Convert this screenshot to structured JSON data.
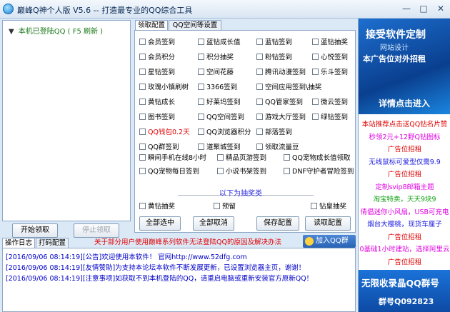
{
  "window": {
    "title": "巅峰Q神个人版 V5.6 -- 打造最专业的QQ综合工具",
    "min": "—",
    "max": "□",
    "close": "✕"
  },
  "tree": {
    "root_label": "本机已登陆QQ ( F5 刷新 )"
  },
  "left_buttons": {
    "start": "开始领取",
    "stop": "停止领取"
  },
  "tabs": [
    "领取配置",
    "QQ空间等设置"
  ],
  "checkboxes": [
    {
      "label": "会员签到",
      "red": false
    },
    {
      "label": "蓝钻成长值",
      "red": false
    },
    {
      "label": "蓝钻签到",
      "red": false
    },
    {
      "label": "蓝钻抽奖",
      "red": false
    },
    {
      "label": "会员积分",
      "red": false
    },
    {
      "label": "积分抽奖",
      "red": false
    },
    {
      "label": "粉钻签到",
      "red": false
    },
    {
      "label": "心悦签到",
      "red": false
    },
    {
      "label": "星钻签到",
      "red": false
    },
    {
      "label": "空间花藤",
      "red": false
    },
    {
      "label": "腾讯动漫签到",
      "red": false
    },
    {
      "label": "乐斗签到",
      "red": false
    },
    {
      "label": "玫瑰小镇刷树",
      "red": false
    },
    {
      "label": "3366签到",
      "red": false
    },
    {
      "label": "空间应用签到\\抽奖",
      "red": false
    },
    {
      "label": "",
      "red": false
    },
    {
      "label": "黄钻成长",
      "red": false
    },
    {
      "label": "好莱坞签到",
      "red": false
    },
    {
      "label": "QQ管家签到",
      "red": false
    },
    {
      "label": "微云签到",
      "red": false
    },
    {
      "label": "图书签到",
      "red": false
    },
    {
      "label": "QQ空间签到",
      "red": false
    },
    {
      "label": "游戏大厅签到",
      "red": false
    },
    {
      "label": "绿钻签到",
      "red": false
    },
    {
      "label": "QQ钱包0.2天",
      "red": true
    },
    {
      "label": "QQ浏览器积分",
      "red": false
    },
    {
      "label": "部落签到",
      "red": false
    },
    {
      "label": "",
      "red": false
    },
    {
      "label": "QQ群签到",
      "red": false
    },
    {
      "label": "道聚城签到",
      "red": false
    },
    {
      "label": "领取流量豆",
      "red": false
    }
  ],
  "row8": [
    {
      "label": "瞬间手机在线8小时"
    },
    {
      "label": "精品页游签到"
    },
    {
      "label": "QQ宠物成长值领取"
    }
  ],
  "row9": [
    {
      "label": "QQ宠物每日签到"
    },
    {
      "label": "小说书架签到"
    },
    {
      "label": "DNF守护者冒险签到"
    }
  ],
  "lottery": {
    "header": "以下为抽奖类",
    "items": [
      {
        "label": "黄钻抽奖"
      },
      {
        "label": "预留"
      },
      {
        "label": "钻皇抽奖"
      }
    ]
  },
  "cfg_buttons": {
    "select_all": "全部选中",
    "cancel_all": "全部取消",
    "save": "保存配置",
    "load": "读取配置"
  },
  "notice": "关于部分用户使用巅峰系列软件无法登陆QQ的原因及解决办法",
  "qq_group_btn": "加入QQ群",
  "bottom_tabs": [
    "操作日志",
    "打码配置"
  ],
  "logs": [
    "[2016/09/06 08:14:19][公告]欢迎使用本软件！ 官网http://www.52dfg.com",
    "[2016/09/06 08:14:19][友情赞助]为支持本论坛本软件不断发展更新，已设置浏览器主页，谢谢！",
    "[2016/09/06 08:14:19][注意事项]如获取不到本机登陆的QQ，请重启电脑或重新安装官方原新QQ！"
  ],
  "ad": {
    "banner_big": "接受软件定制",
    "banner_small": "网站设计",
    "banner_mid": "本广告位对外招租",
    "banner_cta": "详情点击进入",
    "lines": [
      {
        "text": "本站推荐点击送QQ钻名片赞",
        "color": "#e00000"
      },
      {
        "text": "秒领2元+12野Q钻图标",
        "color": "#e000e0"
      },
      {
        "text": "广告位招租",
        "color": "#e00000"
      },
      {
        "text": "无线鼠标可爱型仅需9.9",
        "color": "#2020e0"
      },
      {
        "text": "广告位招租",
        "color": "#e00000"
      },
      {
        "text": "定制svip8邮箱主题",
        "color": "#e000e0"
      },
      {
        "text": "淘宝特卖，天天9块9",
        "color": "#10a010"
      },
      {
        "text": "倩倡迷你小风扇，USB可充电",
        "color": "#e000e0"
      },
      {
        "text": "烟台大樱桃，现货车厘子",
        "color": "#2020e0"
      },
      {
        "text": "广告位招租",
        "color": "#e00000"
      },
      {
        "text": "0基础1小时建站，选择阿里云",
        "color": "#e000e0"
      },
      {
        "text": "广告位招租",
        "color": "#e00000"
      }
    ],
    "bottom_l1": "无限收录晶QQ群号",
    "bottom_l2": "群号Q092823"
  }
}
